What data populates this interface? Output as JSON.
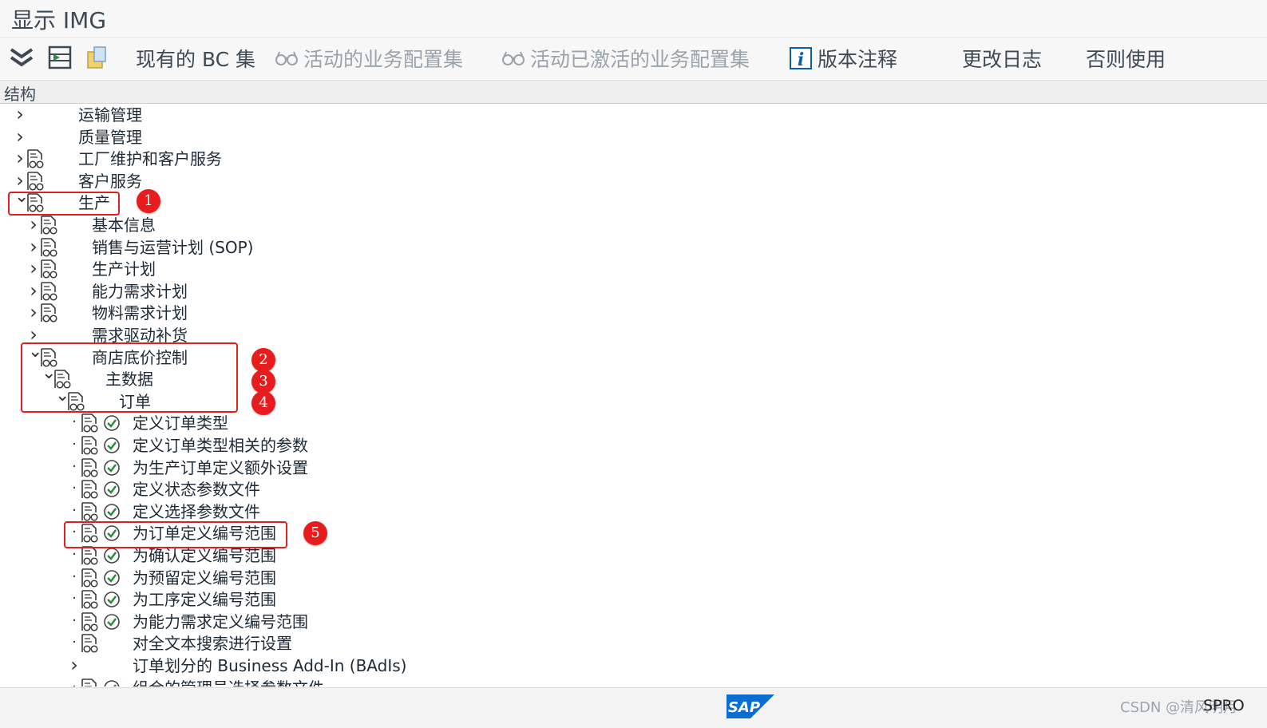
{
  "window": {
    "title": "显示 IMG"
  },
  "toolbar": {
    "existing_bc_sets": "现有的 BC 集",
    "active_bc_sets": "活动的业务配置集",
    "activated_bc_sets": "活动已激活的业务配置集",
    "release_notes": "版本注释",
    "change_log": "更改日志",
    "where_used": "否则使用"
  },
  "structure": {
    "header": "结构"
  },
  "tree": {
    "nodes": [
      {
        "label": "运输管理",
        "level": 0,
        "expander": "collapsed",
        "doc": false,
        "activity": false
      },
      {
        "label": "质量管理",
        "level": 0,
        "expander": "collapsed",
        "doc": false,
        "activity": false
      },
      {
        "label": "工厂维护和客户服务",
        "level": 0,
        "expander": "collapsed",
        "doc": true,
        "activity": false
      },
      {
        "label": "客户服务",
        "level": 0,
        "expander": "collapsed",
        "doc": true,
        "activity": false
      },
      {
        "label": "生产",
        "level": 0,
        "expander": "expanded",
        "doc": true,
        "activity": false
      },
      {
        "label": "基本信息",
        "level": 1,
        "expander": "collapsed",
        "doc": true,
        "activity": false
      },
      {
        "label": "销售与运营计划 (SOP)",
        "level": 1,
        "expander": "collapsed",
        "doc": true,
        "activity": false
      },
      {
        "label": "生产计划",
        "level": 1,
        "expander": "collapsed",
        "doc": true,
        "activity": false
      },
      {
        "label": "能力需求计划",
        "level": 1,
        "expander": "collapsed",
        "doc": true,
        "activity": false
      },
      {
        "label": "物料需求计划",
        "level": 1,
        "expander": "collapsed",
        "doc": true,
        "activity": false
      },
      {
        "label": "需求驱动补货",
        "level": 1,
        "expander": "collapsed",
        "doc": false,
        "activity": false
      },
      {
        "label": "商店底价控制",
        "level": 1,
        "expander": "expanded",
        "doc": true,
        "activity": false
      },
      {
        "label": "主数据",
        "level": 2,
        "expander": "expanded",
        "doc": true,
        "activity": false
      },
      {
        "label": "订单",
        "level": 3,
        "expander": "expanded",
        "doc": true,
        "activity": false
      },
      {
        "label": "定义订单类型",
        "level": 4,
        "expander": "leaf",
        "doc": true,
        "activity": true
      },
      {
        "label": "定义订单类型相关的参数",
        "level": 4,
        "expander": "leaf",
        "doc": true,
        "activity": true
      },
      {
        "label": "为生产订单定义额外设置",
        "level": 4,
        "expander": "leaf",
        "doc": true,
        "activity": true
      },
      {
        "label": "定义状态参数文件",
        "level": 4,
        "expander": "leaf",
        "doc": true,
        "activity": true
      },
      {
        "label": "定义选择参数文件",
        "level": 4,
        "expander": "leaf",
        "doc": true,
        "activity": true
      },
      {
        "label": "为订单定义编号范围",
        "level": 4,
        "expander": "leaf",
        "doc": true,
        "activity": true
      },
      {
        "label": "为确认定义编号范围",
        "level": 4,
        "expander": "leaf",
        "doc": true,
        "activity": true
      },
      {
        "label": "为预留定义编号范围",
        "level": 4,
        "expander": "leaf",
        "doc": true,
        "activity": true
      },
      {
        "label": "为工序定义编号范围",
        "level": 4,
        "expander": "leaf",
        "doc": true,
        "activity": true
      },
      {
        "label": "为能力需求定义编号范围",
        "level": 4,
        "expander": "leaf",
        "doc": true,
        "activity": true
      },
      {
        "label": "对全文本搜索进行设置",
        "level": 4,
        "expander": "leaf",
        "doc": true,
        "activity": false
      },
      {
        "label": "订单划分的 Business Add-In (BAdIs)",
        "level": 4,
        "expander": "collapsed",
        "doc": false,
        "activity": false
      },
      {
        "label": "组合的管理员选择参数文件",
        "level": 4,
        "expander": "leaf",
        "doc": true,
        "activity": true
      }
    ]
  },
  "annotations": [
    "1",
    "2",
    "3",
    "4",
    "5"
  ],
  "statusbar": {
    "watermark": "CSDN @清风明月",
    "transaction": "SPRO"
  },
  "colors": {
    "highlight": "#e02020",
    "badge": "#e81c1c",
    "activity": "#2a8a3a",
    "sap_blue": "#0a6ed1"
  }
}
